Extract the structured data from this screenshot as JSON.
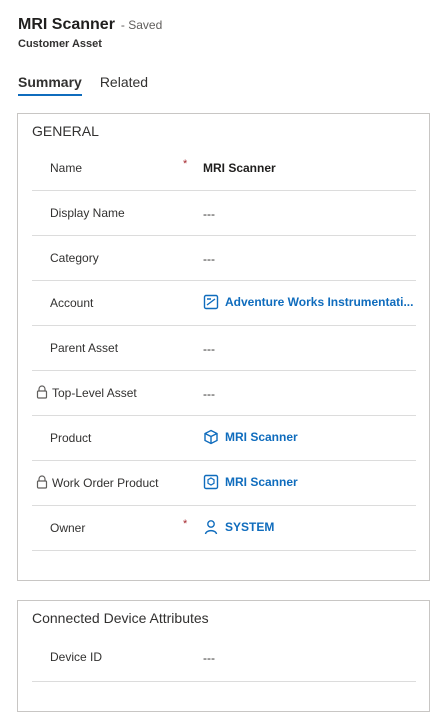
{
  "header": {
    "title": "MRI Scanner",
    "saved_status": "- Saved",
    "entity_type": "Customer Asset"
  },
  "tabs": [
    {
      "label": "Summary",
      "active": true
    },
    {
      "label": "Related",
      "active": false
    }
  ],
  "general": {
    "title": "GENERAL",
    "fields": {
      "name": {
        "label": "Name",
        "required": "*",
        "value": "MRI Scanner"
      },
      "display_name": {
        "label": "Display Name",
        "value": "---"
      },
      "category": {
        "label": "Category",
        "value": "---"
      },
      "account": {
        "label": "Account",
        "value": "Adventure Works Instrumentati...",
        "icon": "account-icon"
      },
      "parent_asset": {
        "label": "Parent Asset",
        "value": "---"
      },
      "top_level_asset": {
        "label": "Top-Level Asset",
        "value": "---",
        "icon": "lock-icon"
      },
      "product": {
        "label": "Product",
        "value": "MRI Scanner",
        "icon": "product-cube-icon"
      },
      "work_order_product": {
        "label": "Work Order Product",
        "value": "MRI Scanner",
        "icon": "lock-icon"
      },
      "owner": {
        "label": "Owner",
        "required": "*",
        "value": "SYSTEM",
        "icon": "person-icon"
      }
    }
  },
  "connected_device": {
    "title": "Connected Device Attributes",
    "fields": {
      "device_id": {
        "label": "Device ID",
        "value": "---"
      }
    }
  },
  "colors": {
    "link": "#0f6cbd",
    "required": "#a4262c",
    "border": "#c8c6c4",
    "divider": "#dcdcdc"
  }
}
